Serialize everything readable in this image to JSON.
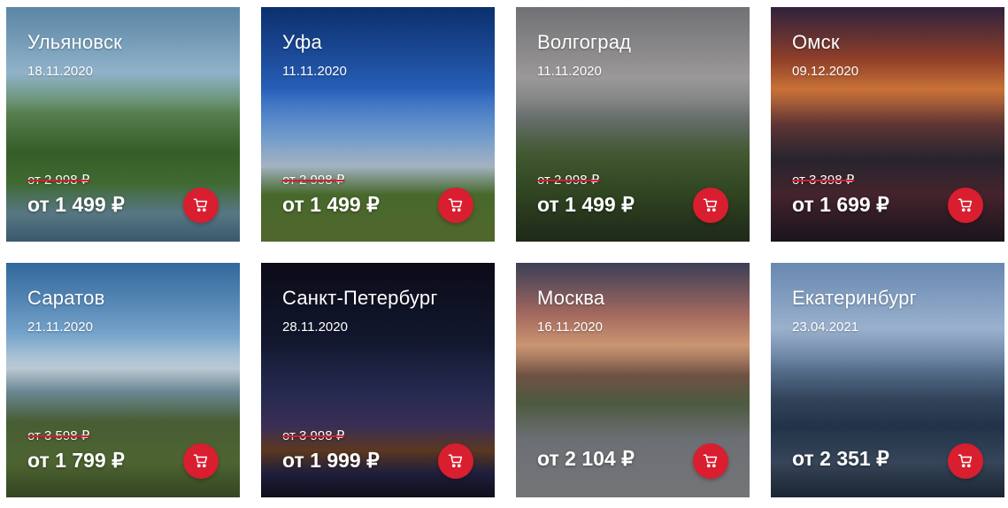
{
  "cards": [
    {
      "city": "Ульяновск",
      "date": "18.11.2020",
      "old_price": "от 2 998 ₽",
      "price": "от 1 499 ₽"
    },
    {
      "city": "Уфа",
      "date": "11.11.2020",
      "old_price": "от 2 998 ₽",
      "price": "от 1 499 ₽"
    },
    {
      "city": "Волгоград",
      "date": "11.11.2020",
      "old_price": "от 2 998 ₽",
      "price": "от 1 499 ₽"
    },
    {
      "city": "Омск",
      "date": "09.12.2020",
      "old_price": "от 3 398 ₽",
      "price": "от 1 699 ₽"
    },
    {
      "city": "Саратов",
      "date": "21.11.2020",
      "old_price": "от 3 598 ₽",
      "price": "от 1 799 ₽"
    },
    {
      "city": "Санкт-Петербург",
      "date": "28.11.2020",
      "old_price": "от 3 998 ₽",
      "price": "от 1 999 ₽"
    },
    {
      "city": "Москва",
      "date": "16.11.2020",
      "old_price": "",
      "price": "от 2 104 ₽"
    },
    {
      "city": "Екатеринбург",
      "date": "23.04.2021",
      "old_price": "",
      "price": "от 2 351 ₽"
    }
  ],
  "colors": {
    "accent": "#d81e2f",
    "text": "#ffffff"
  },
  "icons": {
    "cart": "cart-icon"
  }
}
